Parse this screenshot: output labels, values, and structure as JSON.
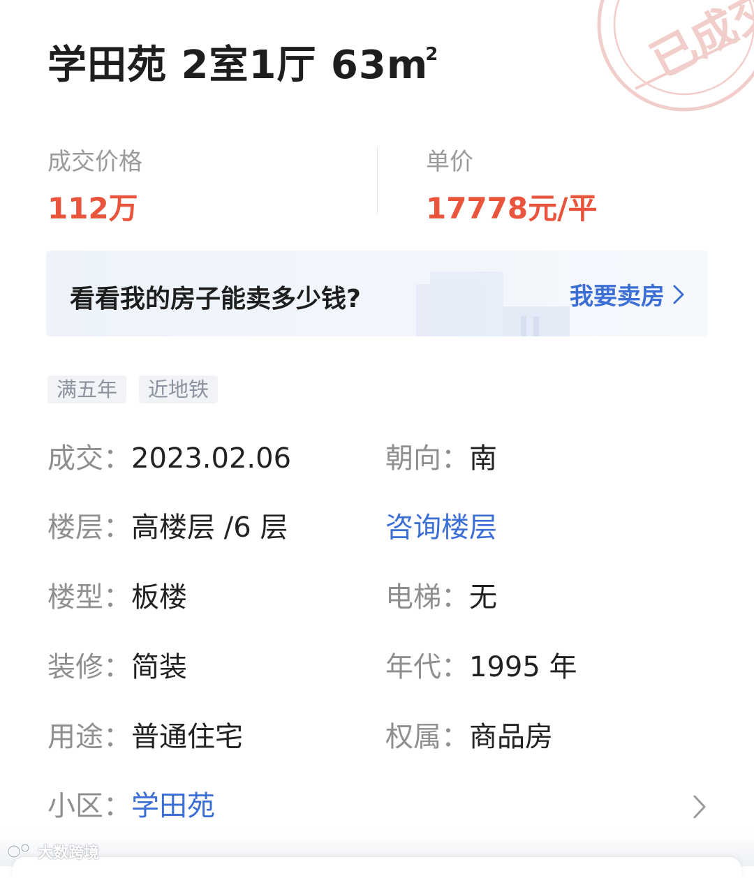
{
  "stamp": {
    "text": "已成交"
  },
  "listing": {
    "title": "学田苑 2室1厅 63m",
    "area_superscript": "2"
  },
  "price": {
    "deal_label": "成交价格",
    "deal_value": "112万",
    "unit_label": "单价",
    "unit_value": "17778元/平"
  },
  "sell_banner": {
    "prompt": "看看我的房子能卖多少钱?",
    "action": "我要卖房"
  },
  "tags": [
    "满五年",
    "近地铁"
  ],
  "details": {
    "deal_date": {
      "label": "成交：",
      "value": "2023.02.06"
    },
    "orientation": {
      "label": "朝向：",
      "value": "南"
    },
    "floor": {
      "label": "楼层：",
      "value": "高楼层 /6 层"
    },
    "consult_floor": "咨询楼层",
    "building_type": {
      "label": "楼型：",
      "value": "板楼"
    },
    "elevator": {
      "label": "电梯：",
      "value": "无"
    },
    "decoration": {
      "label": "装修：",
      "value": "简装"
    },
    "year": {
      "label": "年代：",
      "value": "1995 年"
    },
    "usage": {
      "label": "用途：",
      "value": "普通住宅"
    },
    "ownership": {
      "label": "权属：",
      "value": "商品房"
    },
    "community": {
      "label": "小区：",
      "value": "学田苑"
    }
  },
  "watermark": {
    "text": "大数跨境"
  },
  "colors": {
    "price": "#e8553c",
    "link": "#3c6fd6",
    "label": "#8f8f8f",
    "stamp": "#e9a7a2"
  }
}
